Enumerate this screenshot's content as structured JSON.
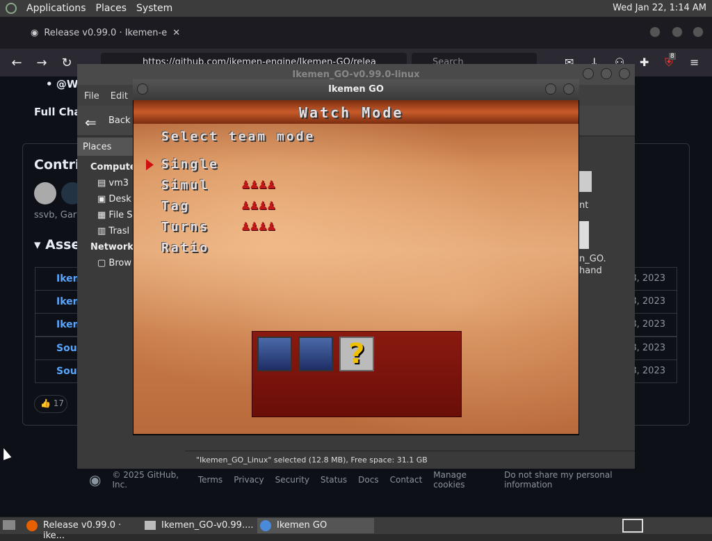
{
  "top_panel": {
    "menus": [
      "Applications",
      "Places",
      "System"
    ],
    "clock": "Wed Jan 22,  1:14 AM"
  },
  "browser": {
    "tab_title": "Release v0.99.0 · Ikemen-e",
    "url": "https://github.com/ikemen-engine/Ikemen-GO/relea",
    "search_placeholder": "Search",
    "badge_count": "8"
  },
  "github": {
    "bullet": "@W",
    "full_changelog": "Full Cha",
    "contributors": "Contril",
    "contrib_names": "ssvb, Gary",
    "assets_heading": "Asse",
    "assets": [
      {
        "name": "Ikem",
        "date": "8, 2023"
      },
      {
        "name": "Ikem",
        "date": "8, 2023"
      },
      {
        "name": "Ikem",
        "date": "8, 2023"
      },
      {
        "name": "Sour",
        "date": "8, 2023"
      },
      {
        "name": "Sour",
        "date": "8, 2023"
      }
    ],
    "reaction_emoji": "👍",
    "reaction_count": "17",
    "footer": [
      "© 2025 GitHub, Inc.",
      "Terms",
      "Privacy",
      "Security",
      "Status",
      "Docs",
      "Contact",
      "Manage cookies",
      "Do not share my personal information"
    ]
  },
  "file_manager": {
    "title": "Ikemen_GO-v0.99.0-linux",
    "menu": [
      "File",
      "Edit"
    ],
    "back_label": "Back",
    "places_label": "Places",
    "sidebar": {
      "computer": "Computer",
      "items": [
        "vm3",
        "Desk",
        "File S",
        "Trasl"
      ],
      "network": "Network",
      "network_items": [
        "Brow"
      ]
    },
    "right_labels": [
      "nt",
      "n_GO.",
      "hand"
    ],
    "status": "\"Ikemen_GO_Linux\" selected (12.8 MB), Free space: 31.1 GB"
  },
  "ikemen": {
    "title": "Ikemen GO",
    "header": "Watch Mode",
    "subtitle": "Select team mode",
    "options": [
      "Single",
      "Simul",
      "Tag",
      "Turns",
      "Ratio"
    ],
    "selected_index": 0,
    "team_icon": "♟♟♟♟",
    "question_mark": "?"
  },
  "taskbar": {
    "items": [
      "Release v0.99.0 · ike...",
      "Ikemen_GO-v0.99....",
      "Ikemen GO"
    ]
  }
}
